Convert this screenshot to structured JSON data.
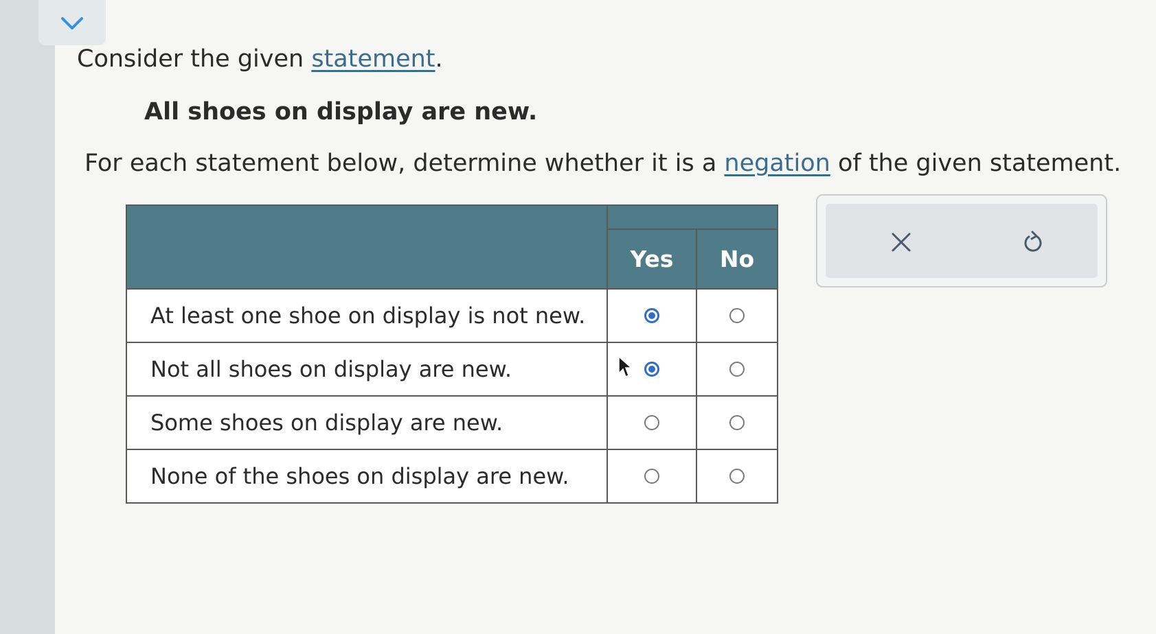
{
  "prompt": {
    "before": "Consider the given ",
    "link": "statement",
    "after": "."
  },
  "statement": "All shoes on display are new.",
  "instruction": {
    "before": "For each statement below, determine whether it is a ",
    "link": "negation",
    "after": " of the given statement."
  },
  "table": {
    "headers": {
      "yes": "Yes",
      "no": "No"
    },
    "rows": [
      {
        "text": "At least one shoe on display is not new.",
        "selected": "yes"
      },
      {
        "text": "Not all shoes on display are new.",
        "selected": "yes"
      },
      {
        "text": "Some shoes on display are new.",
        "selected": null
      },
      {
        "text": "None of the shoes on display are new.",
        "selected": null
      }
    ]
  },
  "tools": {
    "clear_icon": "x-icon",
    "undo_icon": "undo-icon"
  },
  "colors": {
    "header_bg": "#4f7c88",
    "link": "#3a6e8c",
    "radio_selected": "#2f6ec9"
  }
}
